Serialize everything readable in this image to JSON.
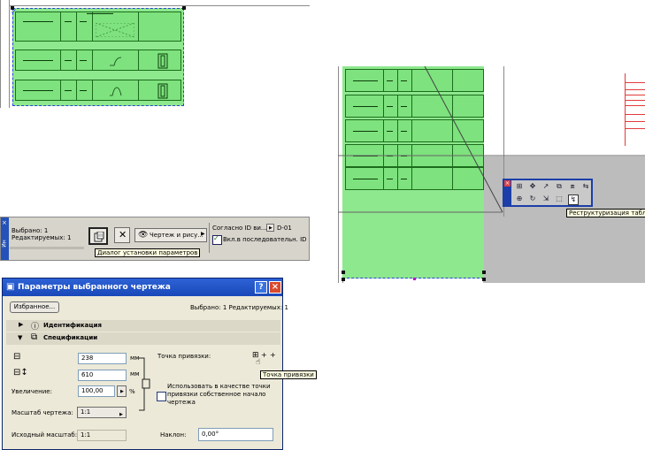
{
  "info_box": {
    "selected": "Выбрано: 1",
    "editable": "Редактируемых: 1",
    "view_button": "Чертеж и рису...",
    "id_source": "Согласно ID ви...",
    "id_value": "D-01",
    "sequential": "Вкл.в последовательн. ID",
    "tooltip": "Диалог установки параметров",
    "side_tab": "Ин"
  },
  "toolbar_tooltip": "Реструктуризация таблицы",
  "dialog": {
    "title": "Параметры выбранного чертежа",
    "favorites_button": "Избранное...",
    "selection_summary": "Выбрано: 1 Редактируемых: 1",
    "section_identification": "Идентификация",
    "section_specifications": "Спецификации",
    "width_value": "238",
    "height_value": "610",
    "unit": "мм",
    "zoom_label": "Увеличение:",
    "zoom_value": "100,00",
    "percent": "%",
    "scale_label": "Масштаб чертежа:",
    "scale_value": "1:1",
    "source_scale_label": "Исходный масштаб:",
    "source_scale_value": "1:1",
    "anchor_label": "Точка привязки:",
    "anchor_tooltip": "Точка привязки",
    "use_origin_checkbox": "Использовать в качестве точки привязки собственное начало чертежа",
    "slope_label": "Наклон:",
    "slope_value": "0,00°"
  },
  "colors": {
    "selection_fill": "#8ee88e",
    "selection_border": "#2d40d9",
    "titlebar": "#2355cc",
    "dialog_bg": "#ece9d8"
  }
}
